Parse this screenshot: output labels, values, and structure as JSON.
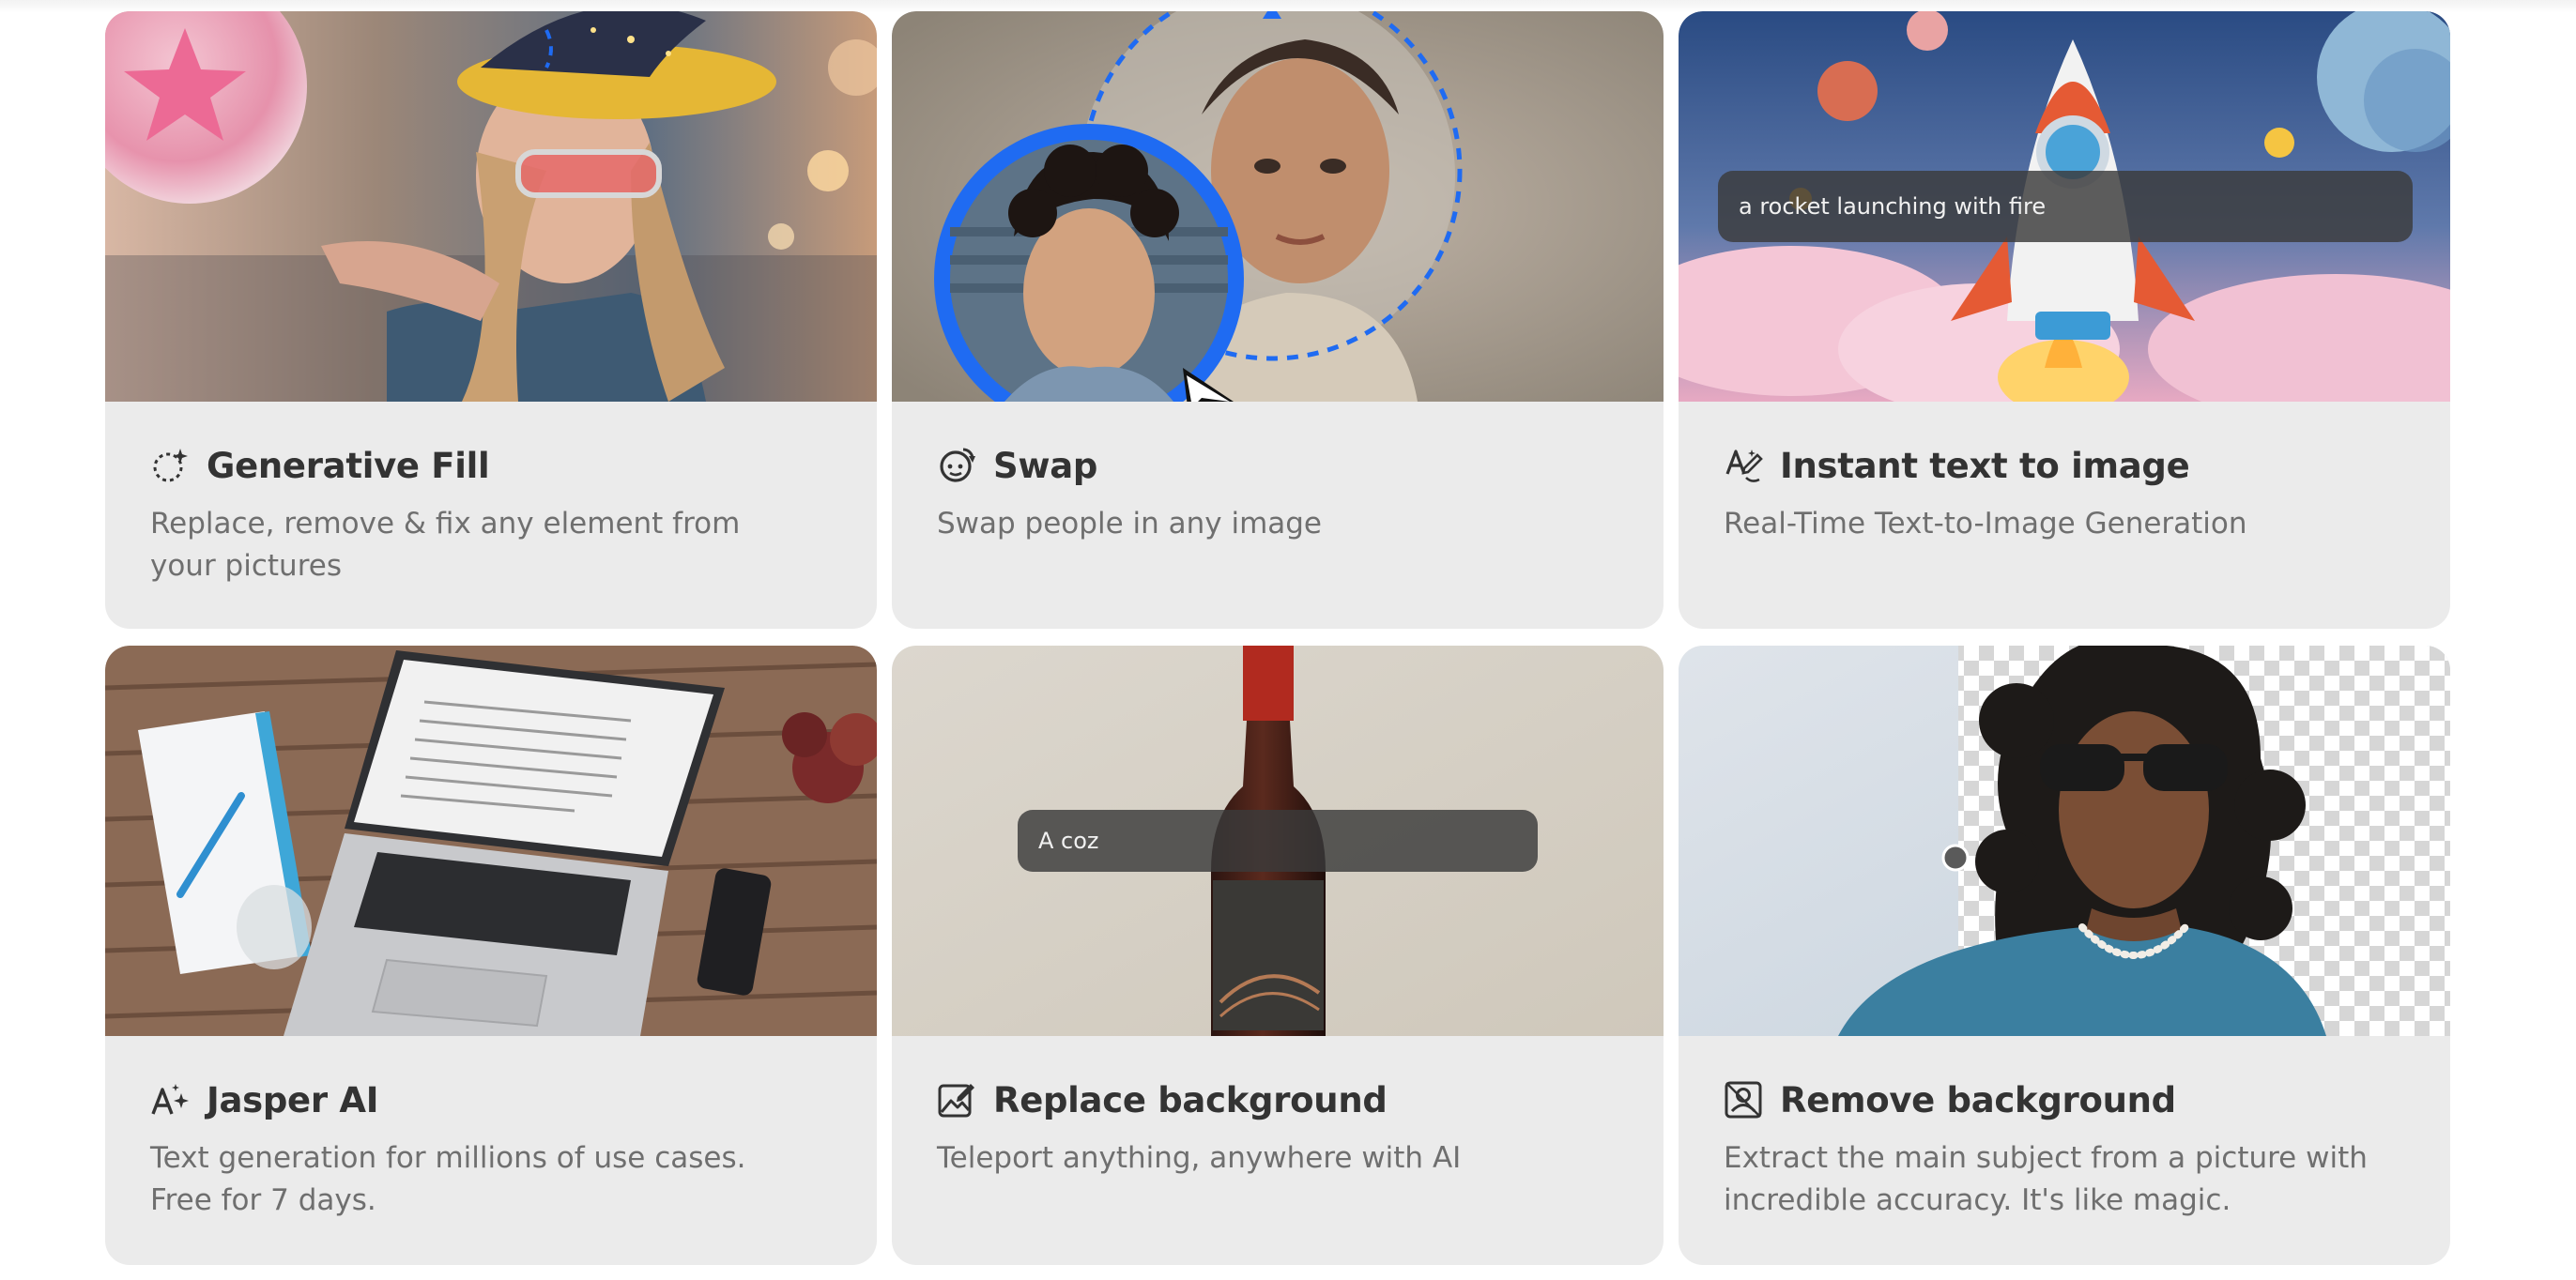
{
  "cards": [
    {
      "title": "Generative Fill",
      "description": "Replace, remove & fix any element from your pictures",
      "icon": "generative-fill-icon"
    },
    {
      "title": "Swap",
      "description": "Swap people in any image",
      "icon": "face-swap-icon"
    },
    {
      "title": "Instant text to image",
      "description": "Real-Time Text-to-Image Generation",
      "icon": "text-to-image-icon",
      "prompt": "a rocket launching with fire"
    },
    {
      "title": "Jasper AI",
      "description": "Text generation for millions of use cases. Free for 7 days.",
      "icon": "ai-text-icon"
    },
    {
      "title": "Replace background",
      "description": "Teleport anything, anywhere with AI",
      "icon": "replace-background-icon",
      "prompt": "A coz"
    },
    {
      "title": "Remove background",
      "description": "Extract the main subject from a picture with incredible accuracy. It's like magic.",
      "icon": "remove-background-icon"
    }
  ],
  "colors": {
    "card_bg": "#ebebeb",
    "title": "#333333",
    "description": "#6f6f6f",
    "accent_blue": "#1f6bf2"
  }
}
